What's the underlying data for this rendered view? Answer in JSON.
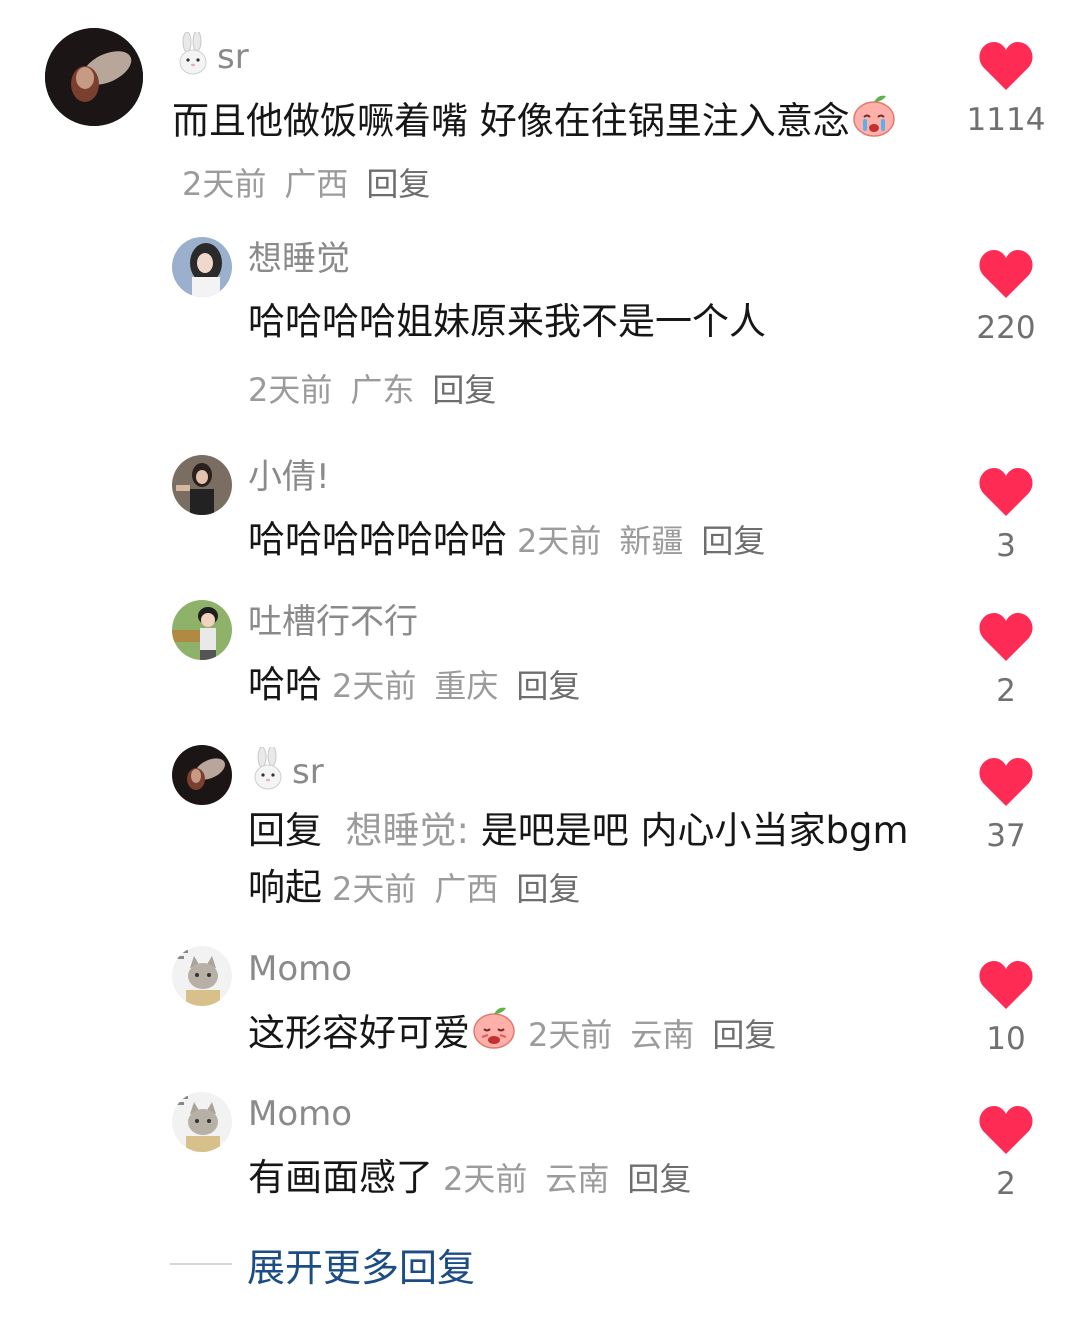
{
  "comments": [
    {
      "user": "sr",
      "text": "而且他做饭噘着嘴 好像在往锅里注入意念",
      "time": "2天前",
      "location": "广西",
      "reply": "回复",
      "likes": "1114"
    },
    {
      "user": "想睡觉",
      "text": "哈哈哈哈姐妹原来我不是一个人",
      "time": "2天前",
      "location": "广东",
      "reply": "回复",
      "likes": "220"
    },
    {
      "user": "小倩!",
      "text": "哈哈哈哈哈哈哈",
      "time": "2天前",
      "location": "新疆",
      "reply": "回复",
      "likes": "3"
    },
    {
      "user": "吐槽行不行",
      "text": "哈哈",
      "time": "2天前",
      "location": "重庆",
      "reply": "回复",
      "likes": "2"
    },
    {
      "user": "sr",
      "reply_prefix": "回复",
      "reply_to": "想睡觉:",
      "text": "是吧是吧 内心小当家bgm响起",
      "time": "2天前",
      "location": "广西",
      "reply": "回复",
      "likes": "37"
    },
    {
      "user": "Momo",
      "text": "这形容好可爱",
      "time": "2天前",
      "location": "云南",
      "reply": "回复",
      "likes": "10"
    },
    {
      "user": "Momo",
      "text": "有画面感了",
      "time": "2天前",
      "location": "云南",
      "reply": "回复",
      "likes": "2"
    }
  ],
  "expand_more": "展开更多回复",
  "icons": {
    "like": "heart-icon",
    "badge": "rabbit-icon",
    "emoji": "peach-crying-emoji"
  },
  "colors": {
    "heart": "#fe2c55",
    "expand": "#1b4c84",
    "meta": "#9b9b9b"
  }
}
